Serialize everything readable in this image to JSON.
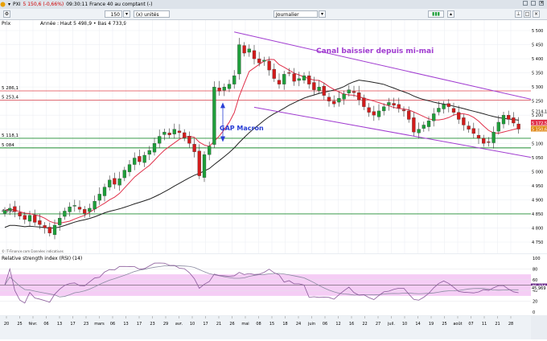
{
  "titlebar": {
    "symbol": "PXI",
    "last": "5 150,6 (-0,66%)",
    "status": "09:30:11 France 40 au comptant (-)"
  },
  "toolbar": {
    "period_count": "150",
    "period_unit": "(x) unités",
    "interval": "Journalier"
  },
  "price_panel": {
    "label": "Prix",
    "info": "Année : Haut 5 498,9 • Bas 4 733,9",
    "watermark": "© IT-Finance.com Données indicatives",
    "annotations": {
      "channel": "Canal baissier depuis mi-mai",
      "gap": "GAP Macron"
    },
    "level_tags": [
      "5 286,1",
      "5 253,4",
      "5 118,1",
      "5 084",
      "4 850"
    ],
    "right_tags": [
      "5 214,1",
      "5 172,5",
      "5 150,6"
    ]
  },
  "rsi_panel": {
    "label": "Relative strength index (RSI) (14)",
    "values_tags": [
      "46,274",
      "45,969"
    ],
    "ticks": [
      "100",
      "80",
      "60",
      "40",
      "20",
      "0"
    ]
  },
  "colors": {
    "up": "#1e9e3a",
    "down": "#d21c1c",
    "ma_short": "#e0304a",
    "ma_long": "#222222",
    "channel": "#a03bd0",
    "support": "#1e8c30",
    "resistance": "#e0404a",
    "rsi_band": "#f5cdf5",
    "rsi_line": "#8a5a9a"
  },
  "icons": [
    "toolbar-icons",
    "window-controls"
  ],
  "chart_data": {
    "type": "candlestick",
    "y_ticks": [
      4750,
      4800,
      4850,
      4900,
      4950,
      5000,
      5050,
      5100,
      5150,
      5200,
      5250,
      5300,
      5350,
      5400,
      5450,
      5500
    ],
    "x_tick_labels": [
      "20",
      "25",
      "févr.",
      "06",
      "13",
      "17",
      "23",
      "mars",
      "06",
      "13",
      "17",
      "23",
      "29",
      "avr.",
      "10",
      "17",
      "21",
      "26",
      "mai",
      "08",
      "15",
      "18",
      "24",
      "juin",
      "06",
      "12",
      "16",
      "22",
      "27",
      "juil.",
      "10",
      "14",
      "19",
      "25",
      "août",
      "07",
      "11",
      "21",
      "28"
    ],
    "levels": {
      "resistance": [
        5286.1,
        5253.4
      ],
      "support": [
        5118.1,
        5084,
        4850
      ]
    },
    "channel": {
      "upper": {
        "from": [
          46,
          5495
        ],
        "to": [
          140,
          5118
        ]
      },
      "lower": {
        "from": [
          50,
          5228
        ],
        "to": [
          140,
          4940
        ]
      }
    },
    "closes": [
      4862,
      4870,
      4858,
      4842,
      4830,
      4845,
      4820,
      4812,
      4800,
      4782,
      4810,
      4835,
      4860,
      4875,
      4880,
      4866,
      4852,
      4870,
      4895,
      4920,
      4945,
      4970,
      4955,
      4975,
      5005,
      5025,
      5048,
      5035,
      5058,
      5075,
      5100,
      5125,
      5140,
      5130,
      5150,
      5138,
      5120,
      5100,
      5070,
      4985,
      5060,
      5090,
      5300,
      5285,
      5300,
      5310,
      5340,
      5450,
      5420,
      5435,
      5400,
      5385,
      5395,
      5360,
      5330,
      5310,
      5345,
      5350,
      5320,
      5330,
      5340,
      5310,
      5290,
      5300,
      5270,
      5250,
      5240,
      5260,
      5275,
      5290,
      5280,
      5255,
      5230,
      5210,
      5200,
      5215,
      5230,
      5245,
      5235,
      5225,
      5215,
      5185,
      5140,
      5150,
      5165,
      5180,
      5205,
      5225,
      5238,
      5230,
      5210,
      5185,
      5165,
      5150,
      5135,
      5118,
      5100,
      5105,
      5140,
      5175,
      5200,
      5185,
      5172,
      5150.6
    ]
  }
}
